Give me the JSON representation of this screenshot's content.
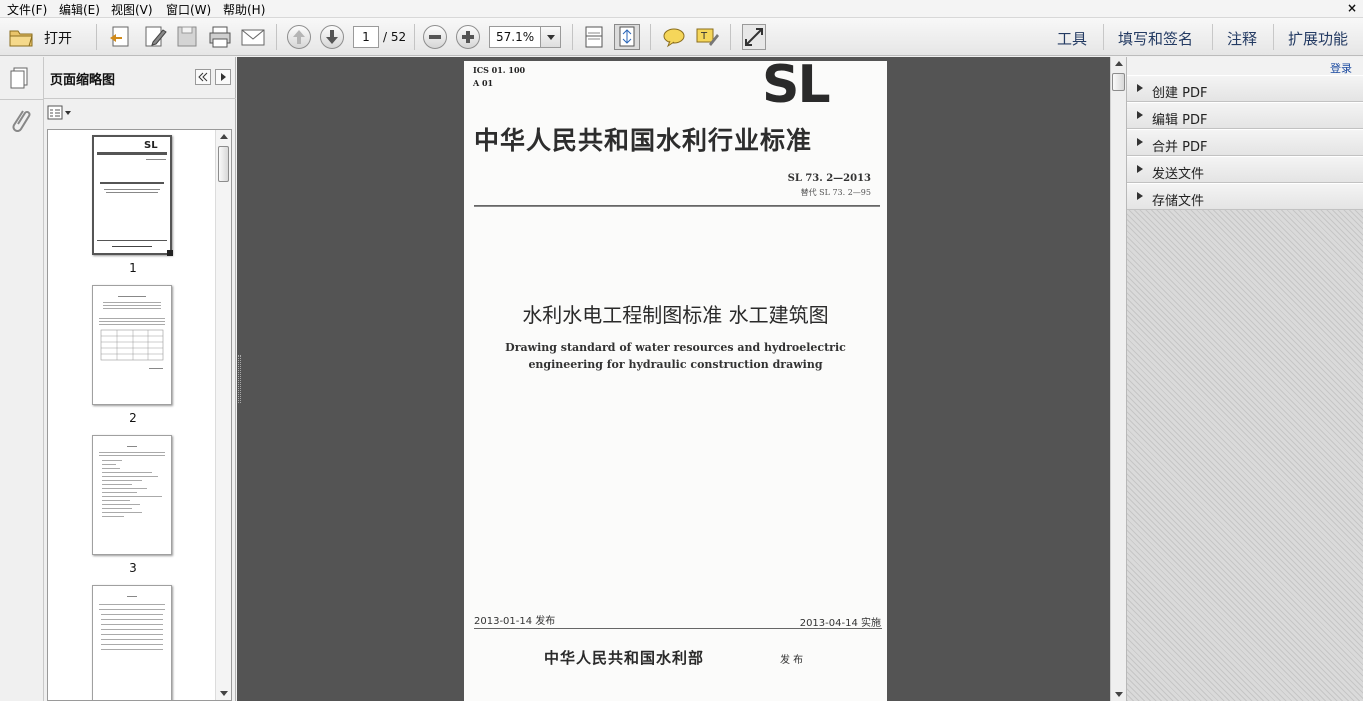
{
  "menu": {
    "file": "文件(F)",
    "edit": "编辑(E)",
    "view": "视图(V)",
    "window": "窗口(W)",
    "help": "帮助(H)",
    "close": "×"
  },
  "toolbar": {
    "open_label": "打开",
    "page_current": "1",
    "page_total": "/ 52",
    "zoom": "57.1%"
  },
  "right_links": {
    "tools": "工具",
    "fill_sign": "填写和签名",
    "comment": "注释",
    "extend": "扩展功能"
  },
  "thumbnails": {
    "title": "页面缩略图",
    "pages": [
      "1",
      "2",
      "3"
    ]
  },
  "document": {
    "ics": "ICS 01. 100",
    "a_code": "A 01",
    "logo": "SL",
    "header": "中华人民共和国水利行业标准",
    "std_no": "SL 73. 2—2013",
    "replaces": "替代 SL 73. 2—95",
    "title_cn": "水利水电工程制图标准  水工建筑图",
    "title_en_1": "Drawing standard of water resources and hydroelectric",
    "title_en_2": "engineering for hydraulic construction drawing",
    "issue_date": "2013-01-14 发布",
    "impl_date": "2013-04-14 实施",
    "issuer": "中华人民共和国水利部",
    "issuer_suffix": "发 布"
  },
  "task_pane": {
    "login": "登录",
    "items": [
      "创建 PDF",
      "编辑 PDF",
      "合并 PDF",
      "发送文件",
      "存储文件"
    ]
  }
}
